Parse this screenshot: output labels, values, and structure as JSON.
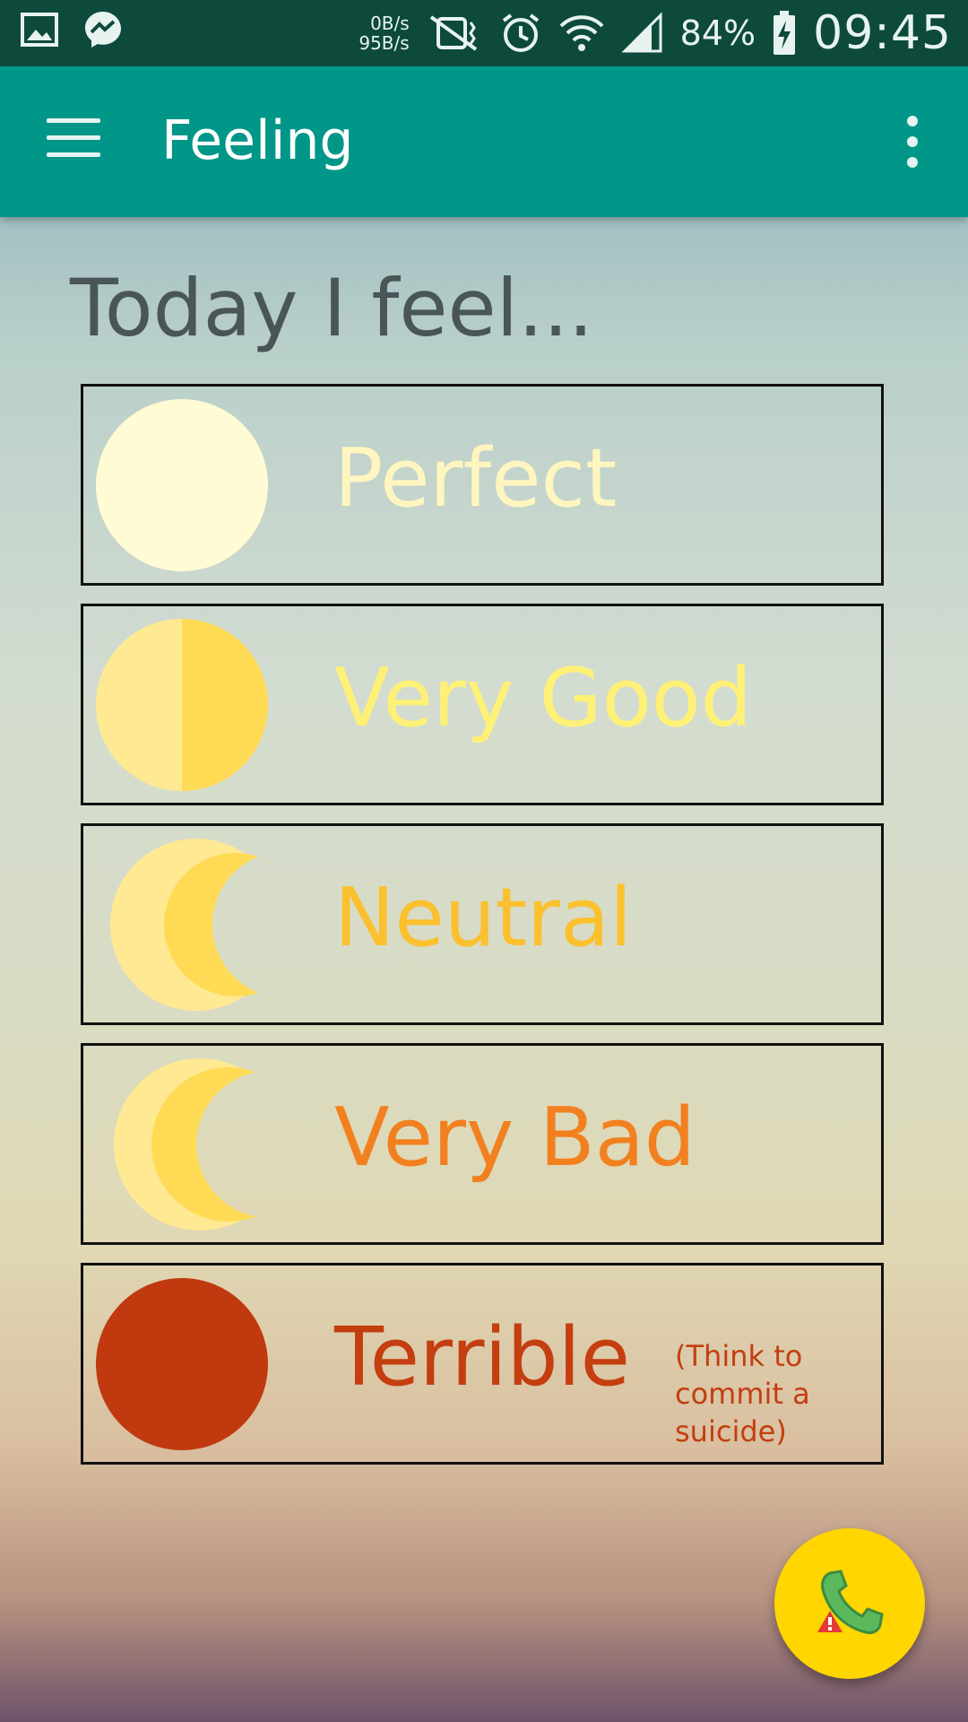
{
  "status_bar": {
    "net_up": "0B/s",
    "net_down": "95B/s",
    "battery": "84%",
    "time": "09:45",
    "icons": [
      "gallery-icon",
      "messenger-icon",
      "vibrate-off-icon",
      "alarm-icon",
      "wifi-icon",
      "signal-icon",
      "battery-charging-icon"
    ]
  },
  "app_bar": {
    "title": "Feeling",
    "color": "#009688"
  },
  "heading": "Today I feel...",
  "options": [
    {
      "label": "Perfect",
      "color": "#fff6bf",
      "icon": "full-moon-icon"
    },
    {
      "label": "Very Good",
      "color": "#fff176",
      "icon": "half-moon-icon"
    },
    {
      "label": "Neutral",
      "color": "#fbc02d",
      "icon": "crescent-moon-icon"
    },
    {
      "label": "Very Bad",
      "color": "#f2801f",
      "icon": "thin-crescent-moon-icon"
    },
    {
      "label": "Terrible",
      "color": "#c43e10",
      "icon": "red-moon-icon",
      "note": "(Think to commit a suicide)"
    }
  ],
  "fab": {
    "icon": "emergency-call-icon",
    "color": "#ffd600"
  }
}
